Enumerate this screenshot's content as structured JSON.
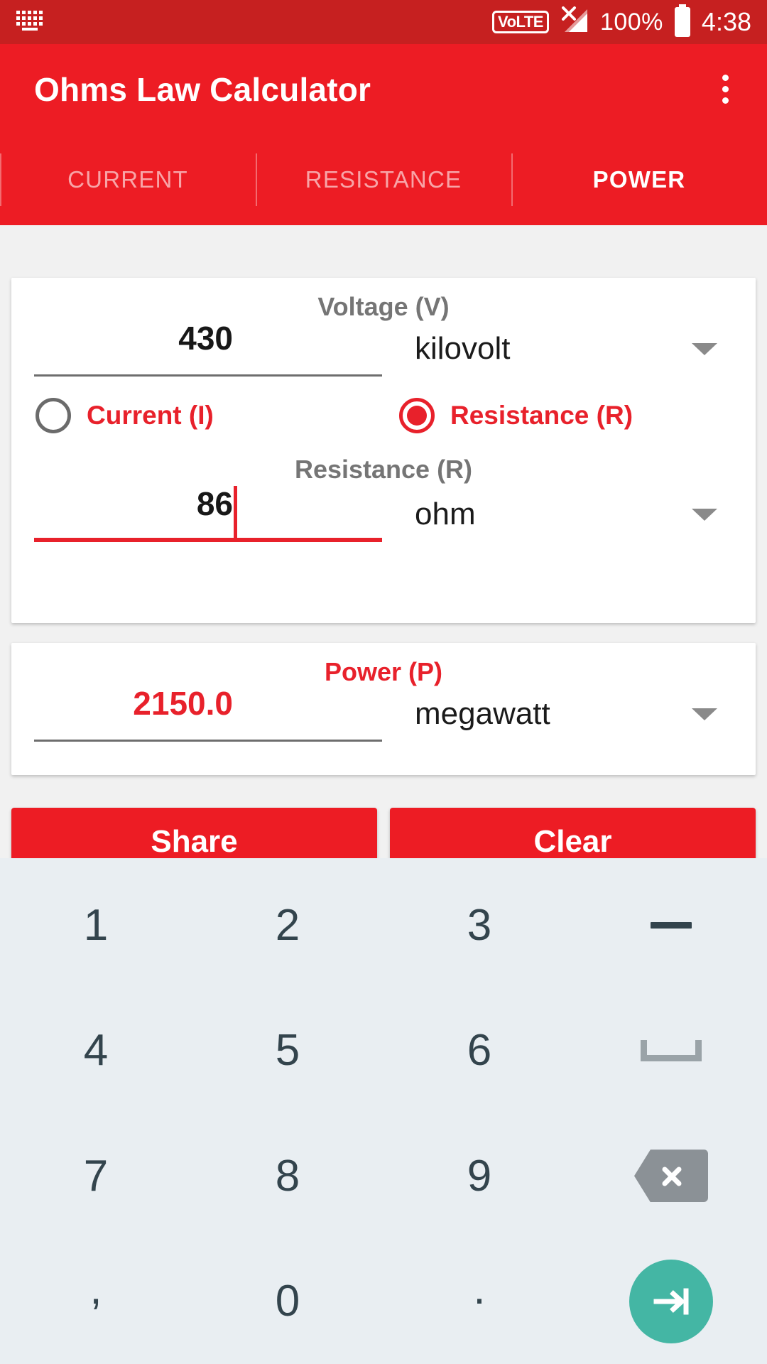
{
  "status_bar": {
    "keyboard_icon": "keyboard-icon",
    "volte_label": "VoLTE",
    "signal_icon": "signal-no-service-icon",
    "battery_percent": "100%",
    "battery_icon": "battery-full-icon",
    "time": "4:38"
  },
  "app_bar": {
    "title": "Ohms Law Calculator",
    "overflow_icon": "overflow-menu-icon"
  },
  "tabs": [
    {
      "label": "CURRENT",
      "active": false
    },
    {
      "label": "RESISTANCE",
      "active": false
    },
    {
      "label": "POWER",
      "active": true
    }
  ],
  "input_card": {
    "voltage": {
      "label": "Voltage (V)",
      "value": "430",
      "unit": "kilovolt",
      "dropdown_icon": "chevron-down-icon"
    },
    "mode_options": [
      {
        "label": "Current (I)",
        "selected": false
      },
      {
        "label": "Resistance (R)",
        "selected": true
      }
    ],
    "second_field": {
      "label": "Resistance (R)",
      "value": "86",
      "unit": "ohm",
      "dropdown_icon": "chevron-down-icon",
      "focused": true
    }
  },
  "result_card": {
    "label": "Power (P)",
    "value": "2150.0",
    "unit": "megawatt",
    "dropdown_icon": "chevron-down-icon"
  },
  "actions": {
    "share_label": "Share",
    "clear_label": "Clear"
  },
  "keyboard": {
    "rows": [
      [
        {
          "label": "1",
          "type": "digit"
        },
        {
          "label": "2",
          "type": "digit"
        },
        {
          "label": "3",
          "type": "digit"
        },
        {
          "label": "",
          "type": "minus",
          "icon": "minus-icon"
        }
      ],
      [
        {
          "label": "4",
          "type": "digit"
        },
        {
          "label": "5",
          "type": "digit"
        },
        {
          "label": "6",
          "type": "digit"
        },
        {
          "label": "",
          "type": "space",
          "icon": "spacebar-icon"
        }
      ],
      [
        {
          "label": "7",
          "type": "digit"
        },
        {
          "label": "8",
          "type": "digit"
        },
        {
          "label": "9",
          "type": "digit"
        },
        {
          "label": "",
          "type": "backspace",
          "icon": "backspace-icon"
        }
      ],
      [
        {
          "label": ",",
          "type": "comma"
        },
        {
          "label": "0",
          "type": "digit"
        },
        {
          "label": ".",
          "type": "dot"
        },
        {
          "label": "",
          "type": "enter",
          "icon": "enter-arrow-icon"
        }
      ]
    ]
  },
  "colors": {
    "brand_red": "#ed1c24",
    "status_red": "#c62020",
    "accent_red": "#e8212b",
    "keyboard_bg": "#e9eef2",
    "enter_green": "#44b6a4",
    "label_gray": "#757575"
  }
}
